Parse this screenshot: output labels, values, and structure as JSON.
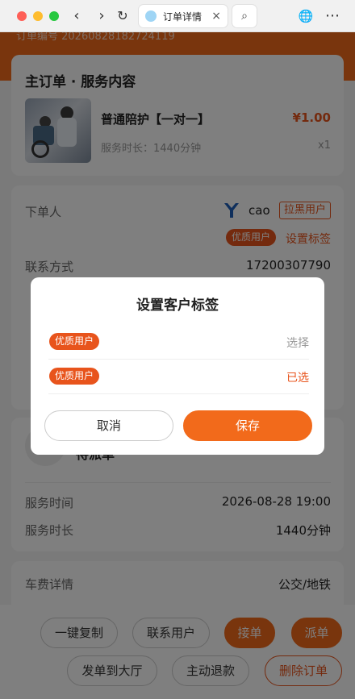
{
  "browser": {
    "tab_title": "订单详情",
    "tab_close": "×",
    "back": "‹",
    "forward": "›",
    "reload": "↻",
    "search": "⌕",
    "globe": "🌐",
    "more": "⋯"
  },
  "order": {
    "order_number": "订单编号 20260828182724119",
    "main_title": "主订单 · 服务内容",
    "service_name": "普通陪护【一对一】",
    "price": "¥1.00",
    "duration": "服务时长：1440分钟",
    "quantity": "x1"
  },
  "customer": {
    "label": "下单人",
    "username": "cao",
    "blacklist_label": "拉黑用户",
    "tag": "优质用户",
    "set_tag_label": "设置标签",
    "contact_label": "联系方式",
    "contact_value": "17200307790"
  },
  "dispatch": {
    "status": "待派单",
    "service_time_label": "服务时间",
    "service_time_value": "2026-08-28 19:00",
    "service_duration_label": "服务时长",
    "service_duration_value": "1440分钟",
    "fare_label": "车费详情",
    "fare_value": "公交/地铁"
  },
  "actions": {
    "copy": "一键复制",
    "contact_user": "联系用户",
    "accept": "接单",
    "dispatch": "派单",
    "to_hall": "发单到大厅",
    "refund": "主动退款",
    "delete": "删除订单"
  },
  "dialog": {
    "title": "设置客户标签",
    "options": [
      {
        "tag": "优质用户",
        "action": "选择",
        "selected": false
      },
      {
        "tag": "优质用户",
        "action": "已选",
        "selected": true
      }
    ],
    "cancel": "取消",
    "save": "保存"
  },
  "colors": {
    "accent": "#f26a1b",
    "danger": "#e8541c"
  }
}
